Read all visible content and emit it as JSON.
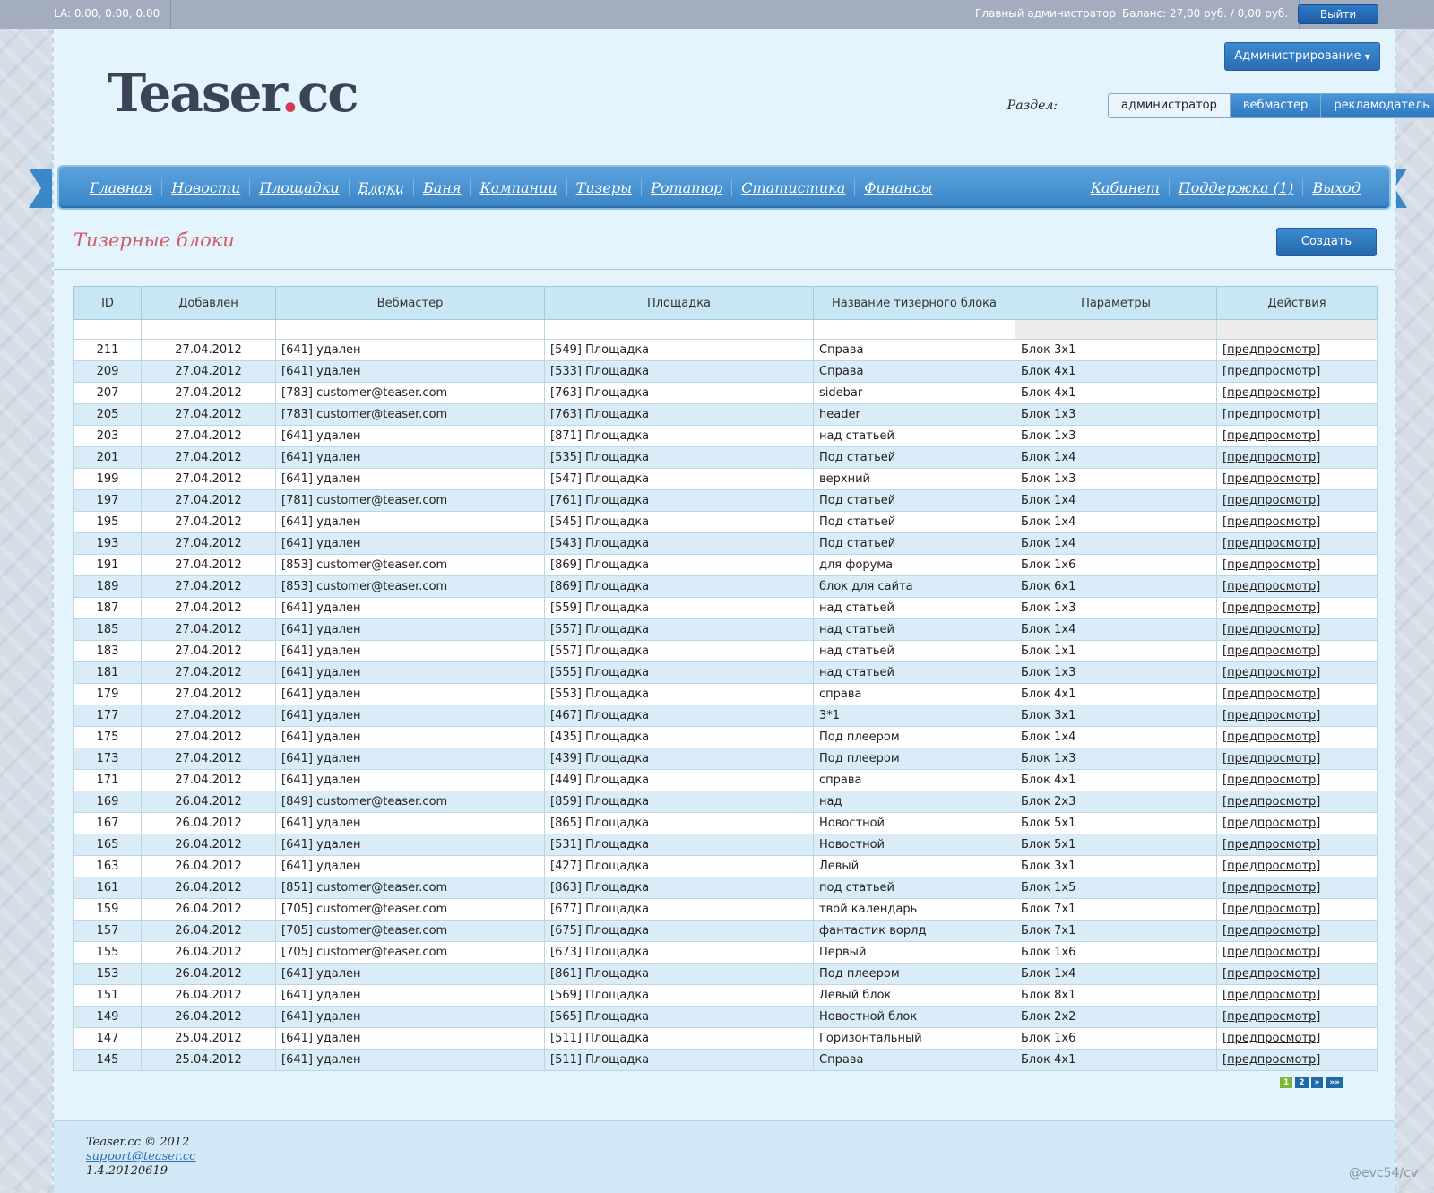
{
  "topbar": {
    "la": "LA: 0.00, 0.00, 0.00",
    "role": "Главный администратор",
    "balance": "Баланс: 27,00 руб. / 0,00 руб.",
    "logout": "Выйти"
  },
  "header": {
    "logo_main": "Teaser",
    "logo_dot": ".",
    "logo_tld": "cc",
    "admin_menu": "Администрирование",
    "section_label": "Раздел:",
    "sections": [
      "администратор",
      "вебмастер",
      "рекламодатель"
    ]
  },
  "nav": {
    "left": [
      "Главная",
      "Новости",
      "Площадки",
      "Блоки",
      "Баня",
      "Кампании",
      "Тизеры",
      "Ротатор",
      "Статистика",
      "Финансы"
    ],
    "right": [
      "Кабинет",
      "Поддержка (1)",
      "Выход"
    ]
  },
  "page": {
    "title": "Тизерные блоки",
    "create_button": "Создать"
  },
  "table": {
    "headers": [
      "ID",
      "Добавлен",
      "Вебмастер",
      "Площадка",
      "Название тизерного блока",
      "Параметры",
      "Действия"
    ],
    "action_label": "[предпросмотр]",
    "rows": [
      [
        "211",
        "27.04.2012",
        "[641] удален",
        "[549] Площадка",
        "Справа",
        "Блок 3x1"
      ],
      [
        "209",
        "27.04.2012",
        "[641] удален",
        "[533] Площадка",
        "Справа",
        "Блок 4x1"
      ],
      [
        "207",
        "27.04.2012",
        "[783] customer@teaser.com",
        "[763] Площадка",
        "sidebar",
        "Блок 4x1"
      ],
      [
        "205",
        "27.04.2012",
        "[783] customer@teaser.com",
        "[763] Площадка",
        "header",
        "Блок 1x3"
      ],
      [
        "203",
        "27.04.2012",
        "[641] удален",
        "[871] Площадка",
        "над статьей",
        "Блок 1x3"
      ],
      [
        "201",
        "27.04.2012",
        "[641] удален",
        "[535] Площадка",
        "Под статьей",
        "Блок 1x4"
      ],
      [
        "199",
        "27.04.2012",
        "[641] удален",
        "[547] Площадка",
        "верхний",
        "Блок 1x3"
      ],
      [
        "197",
        "27.04.2012",
        "[781] customer@teaser.com",
        "[761] Площадка",
        "Под статьей",
        "Блок 1x4"
      ],
      [
        "195",
        "27.04.2012",
        "[641] удален",
        "[545] Площадка",
        "Под статьей",
        "Блок 1x4"
      ],
      [
        "193",
        "27.04.2012",
        "[641] удален",
        "[543] Площадка",
        "Под статьей",
        "Блок 1x4"
      ],
      [
        "191",
        "27.04.2012",
        "[853] customer@teaser.com",
        "[869] Площадка",
        "для форума",
        "Блок 1x6"
      ],
      [
        "189",
        "27.04.2012",
        "[853] customer@teaser.com",
        "[869] Площадка",
        "блок для сайта",
        "Блок 6x1"
      ],
      [
        "187",
        "27.04.2012",
        "[641] удален",
        "[559] Площадка",
        "над статьей",
        "Блок 1x3"
      ],
      [
        "185",
        "27.04.2012",
        "[641] удален",
        "[557] Площадка",
        "над статьей",
        "Блок 1x4"
      ],
      [
        "183",
        "27.04.2012",
        "[641] удален",
        "[557] Площадка",
        "над статьей",
        "Блок 1x1"
      ],
      [
        "181",
        "27.04.2012",
        "[641] удален",
        "[555] Площадка",
        "над статьей",
        "Блок 1x3"
      ],
      [
        "179",
        "27.04.2012",
        "[641] удален",
        "[553] Площадка",
        "справа",
        "Блок 4x1"
      ],
      [
        "177",
        "27.04.2012",
        "[641] удален",
        "[467] Площадка",
        "3*1",
        "Блок 3x1"
      ],
      [
        "175",
        "27.04.2012",
        "[641] удален",
        "[435] Площадка",
        "Под плеером",
        "Блок 1x4"
      ],
      [
        "173",
        "27.04.2012",
        "[641] удален",
        "[439] Площадка",
        "Под плеером",
        "Блок 1x3"
      ],
      [
        "171",
        "27.04.2012",
        "[641] удален",
        "[449] Площадка",
        "справа",
        "Блок 4x1"
      ],
      [
        "169",
        "26.04.2012",
        "[849] customer@teaser.com",
        "[859] Площадка",
        "над",
        "Блок 2x3"
      ],
      [
        "167",
        "26.04.2012",
        "[641] удален",
        "[865] Площадка",
        "Новостной",
        "Блок 5x1"
      ],
      [
        "165",
        "26.04.2012",
        "[641] удален",
        "[531] Площадка",
        "Новостной",
        "Блок 5x1"
      ],
      [
        "163",
        "26.04.2012",
        "[641] удален",
        "[427] Площадка",
        "Левый",
        "Блок 3x1"
      ],
      [
        "161",
        "26.04.2012",
        "[851] customer@teaser.com",
        "[863] Площадка",
        "под статьей",
        "Блок 1x5"
      ],
      [
        "159",
        "26.04.2012",
        "[705] customer@teaser.com",
        "[677] Площадка",
        "твой календарь",
        "Блок 7x1"
      ],
      [
        "157",
        "26.04.2012",
        "[705] customer@teaser.com",
        "[675] Площадка",
        "фантастик ворлд",
        "Блок 7x1"
      ],
      [
        "155",
        "26.04.2012",
        "[705] customer@teaser.com",
        "[673] Площадка",
        "Первый",
        "Блок 1x6"
      ],
      [
        "153",
        "26.04.2012",
        "[641] удален",
        "[861] Площадка",
        "Под плеером",
        "Блок 1x4"
      ],
      [
        "151",
        "26.04.2012",
        "[641] удален",
        "[569] Площадка",
        "Левый блок",
        "Блок 8x1"
      ],
      [
        "149",
        "26.04.2012",
        "[641] удален",
        "[565] Площадка",
        "Новостной блок",
        "Блок 2x2"
      ],
      [
        "147",
        "25.04.2012",
        "[641] удален",
        "[511] Площадка",
        "Горизонтальный",
        "Блок 1x6"
      ],
      [
        "145",
        "25.04.2012",
        "[641] удален",
        "[511] Площадка",
        "Справа",
        "Блок 4x1"
      ]
    ]
  },
  "pager": {
    "current": "1",
    "pages": [
      "2",
      "»",
      "»»"
    ]
  },
  "footer": {
    "copyright": "Teaser.cc © 2012",
    "email": "support@teaser.cc",
    "version": "1.4.20120619"
  },
  "watermark": "@evc54/cv",
  "colors": {
    "accent_blue": "#3a84c6",
    "title_pink": "#d05a6a",
    "row_alt": "#d9ecf8",
    "pager_current": "#7ab836"
  }
}
